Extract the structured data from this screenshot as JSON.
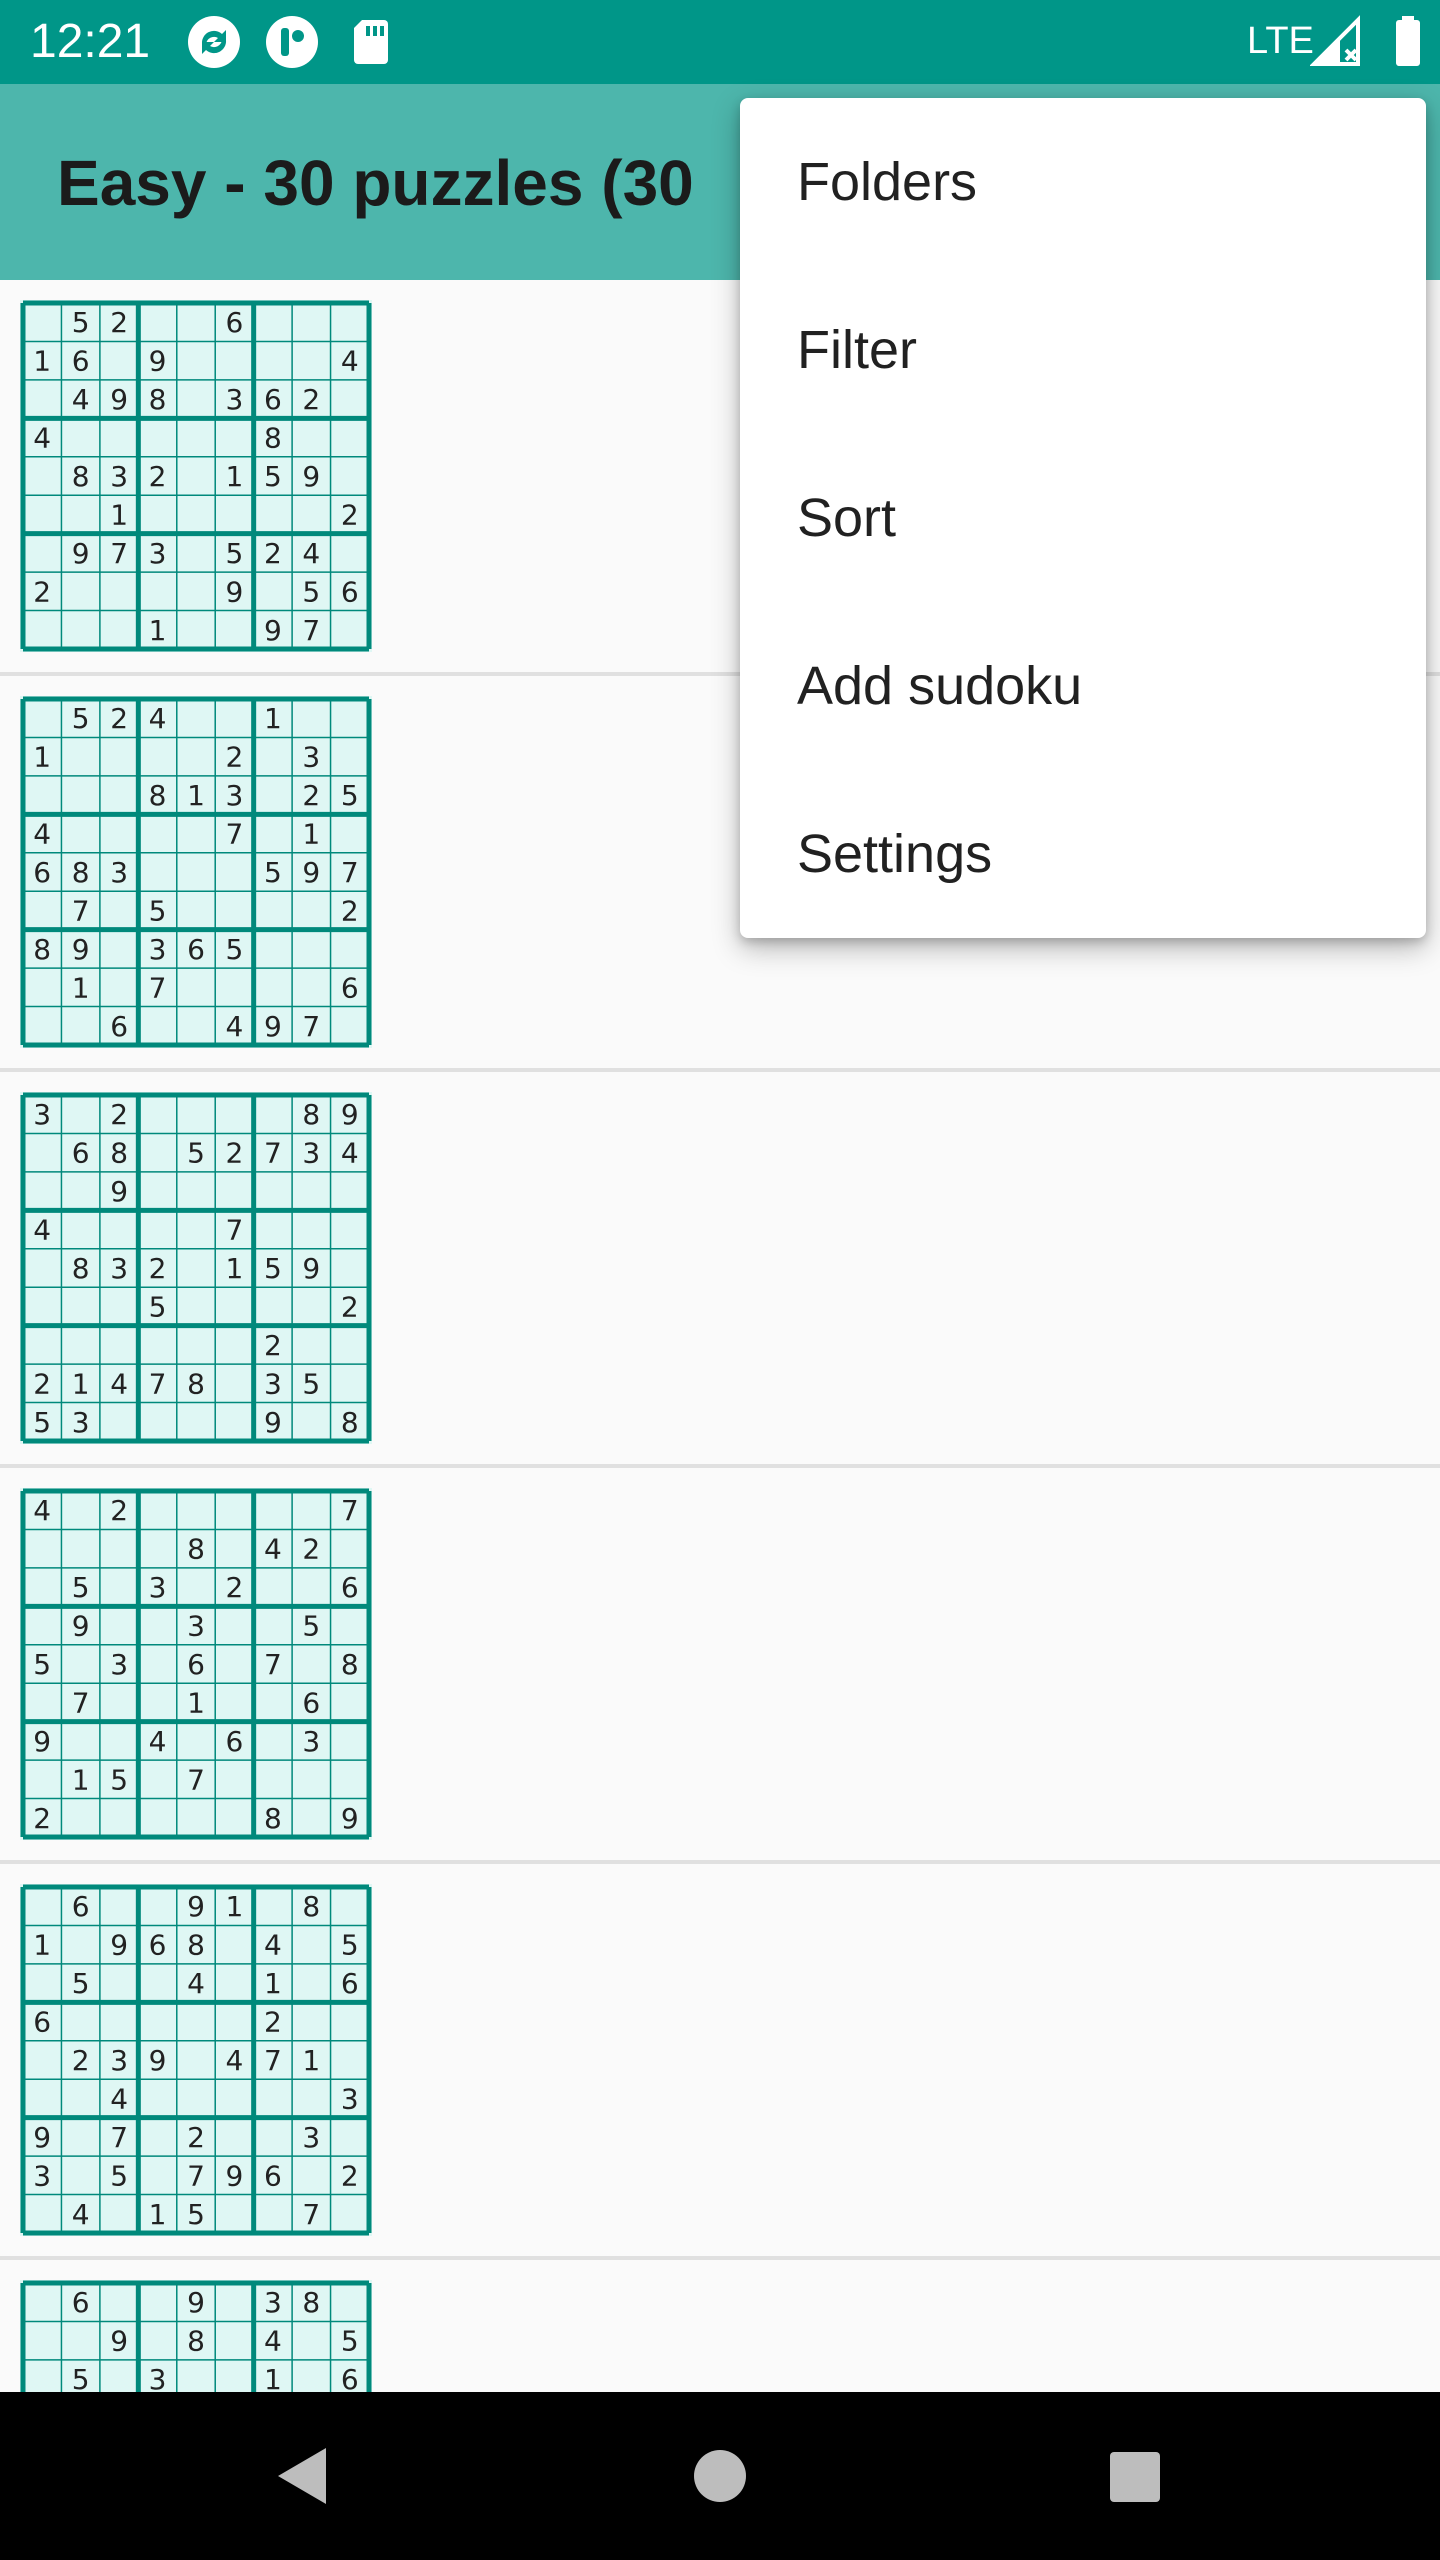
{
  "status_bar": {
    "time": "12:21",
    "network": "LTE",
    "icons": [
      "sync-app-icon",
      "notification-app-icon",
      "sd-card-icon",
      "signal-icon",
      "battery-icon"
    ]
  },
  "app_bar": {
    "title": "Easy - 30 puzzles (30"
  },
  "menu": {
    "items": [
      "Folders",
      "Filter",
      "Sort",
      "Add sudoku",
      "Settings"
    ]
  },
  "colors": {
    "status_bar": "#009688",
    "app_bar": "#4db6ac",
    "grid_line": "#00897b",
    "cell_fill": "#dff7f4"
  },
  "puzzles": [
    [
      "052006000",
      "160900004",
      "049803620",
      "400000800",
      "083201590",
      "001000002",
      "097305240",
      "200009056",
      "000100970"
    ],
    [
      "052400100",
      "100002030",
      "000813025",
      "400007010",
      "683000597",
      "070500002",
      "890365000",
      "010700006",
      "006004970"
    ],
    [
      "302000089",
      "068052734",
      "009000000",
      "400007000",
      "083201590",
      "000500002",
      "000000200",
      "214780350",
      "530000908"
    ],
    [
      "402000007",
      "000080420",
      "050302006",
      "090030050",
      "503060708",
      "070010060",
      "900406030",
      "015070000",
      "200000809"
    ],
    [
      "060091080",
      "109680405",
      "050040106",
      "600000200",
      "023904710",
      "004000003",
      "907020030",
      "305079602",
      "040150070"
    ],
    [
      "060090380",
      "009080405",
      "050300106",
      "000000000",
      "000000000",
      "000000000",
      "000000000",
      "000000000",
      "000000000"
    ]
  ],
  "nav_bar": {
    "buttons": [
      "back",
      "home",
      "recents"
    ]
  }
}
